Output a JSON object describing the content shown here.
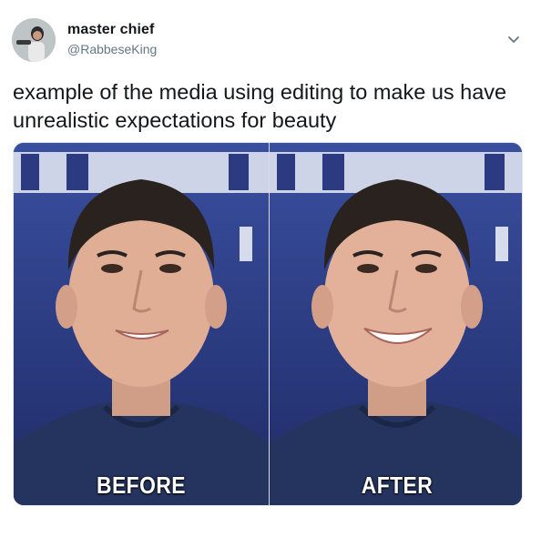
{
  "author": {
    "name": "master chief",
    "handle": "@RabbeseKing"
  },
  "tweet": {
    "text": "example of the media using editing to make us have unrealistic expectations for beauty"
  },
  "media": {
    "before_label": "BEFORE",
    "after_label": "AFTER"
  },
  "icons": {
    "menu": "chevron-down-icon"
  },
  "colors": {
    "name": "#14171a",
    "handle": "#657786",
    "caret": "#657786",
    "backdrop": "#2a3a7a"
  }
}
